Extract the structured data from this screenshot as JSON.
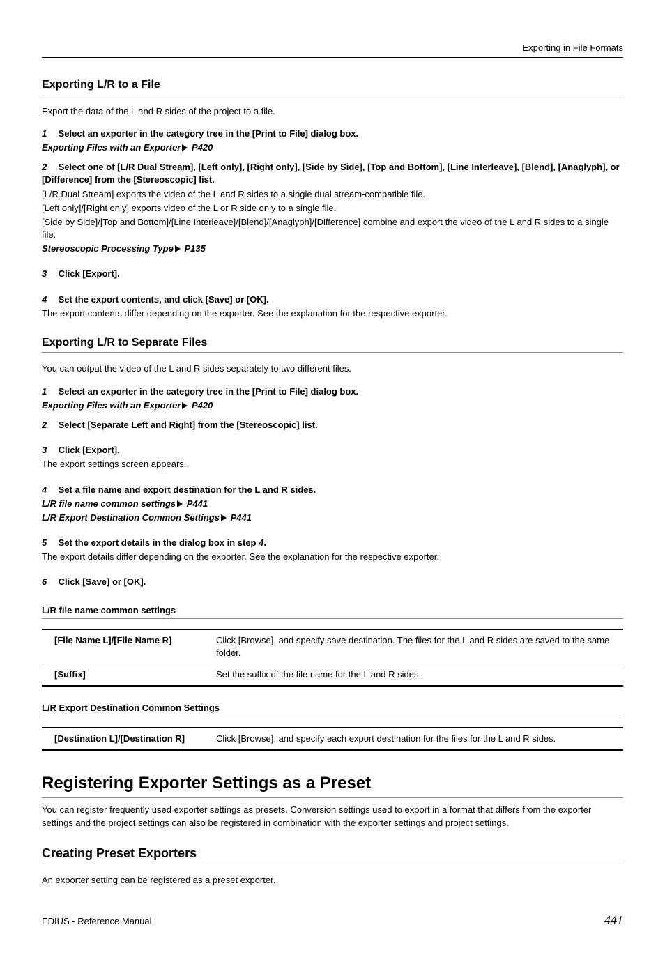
{
  "header": {
    "right": "Exporting in File Formats"
  },
  "sec1": {
    "title": "Exporting L/R to a File",
    "intro": "Export the data of the L and R sides of the project to a file.",
    "step1": {
      "num": "1",
      "text": "Select an exporter in the category tree in the [Print to File] dialog box."
    },
    "link1": {
      "label": "Exporting Files with an Exporter",
      "page": "P420"
    },
    "step2": {
      "num": "2",
      "text": "Select one of [L/R Dual Stream], [Left only], [Right only], [Side by Side], [Top and Bottom], [Line Interleave], [Blend], [Anaglyph], or [Difference] from the [Stereoscopic] list."
    },
    "body1": "[L/R Dual Stream] exports the video of the L and R sides to a single dual stream-compatible file.",
    "body2": "[Left only]/[Right only] exports video of the L or R side only to a single file.",
    "body3": "[Side by Side]/[Top and Bottom]/[Line Interleave]/[Blend]/[Anaglyph]/[Difference] combine and export the video of the L and R sides to a single file.",
    "link2": {
      "label": "Stereoscopic Processing Type",
      "page": "P135"
    },
    "step3": {
      "num": "3",
      "text": "Click [Export]."
    },
    "step4": {
      "num": "4",
      "text": "Set the export contents, and click [Save] or [OK]."
    },
    "body4": "The export contents differ depending on the exporter. See the explanation for the respective exporter."
  },
  "sec2": {
    "title": "Exporting L/R to Separate Files",
    "intro": "You can output the video of the L and R sides separately to two different files.",
    "step1": {
      "num": "1",
      "text": "Select an exporter in the category tree in the [Print to File] dialog box."
    },
    "link1": {
      "label": "Exporting Files with an Exporter",
      "page": "P420"
    },
    "step2": {
      "num": "2",
      "text": "Select [Separate Left and Right] from the [Stereoscopic] list."
    },
    "step3": {
      "num": "3",
      "text": "Click [Export]."
    },
    "body3": "The export settings screen appears.",
    "step4": {
      "num": "4",
      "text": "Set a file name and export destination for the L and R sides."
    },
    "link4a": {
      "label": "L/R file name common settings",
      "page": "P441"
    },
    "link4b": {
      "label": "L/R Export Destination Common Settings",
      "page": "P441"
    },
    "step5": {
      "num": "5",
      "text_a": "Set the export details in the dialog box in step ",
      "text_b": "4",
      "text_c": "."
    },
    "body5": "The export details differ depending on the exporter. See the explanation for the respective exporter.",
    "step6": {
      "num": "6",
      "text": "Click [Save] or [OK]."
    }
  },
  "table1": {
    "heading": "L/R file name common settings",
    "rows": [
      {
        "key": "[File Name L]/[File Name R]",
        "val": "Click [Browse], and specify save destination. The files for the L and R sides are saved to the same folder."
      },
      {
        "key": "[Suffix]",
        "val": "Set the suffix of the file name for the L and R sides."
      }
    ]
  },
  "table2": {
    "heading": "L/R Export Destination Common Settings",
    "rows": [
      {
        "key": "[Destination L]/[Destination R]",
        "val": "Click [Browse], and specify each export destination for the files for the L and R sides."
      }
    ]
  },
  "sec3": {
    "title": "Registering Exporter Settings as a Preset",
    "intro": "You can register frequently used exporter settings as presets. Conversion settings used to export in a format that differs from the exporter settings and the project settings can also be registered in combination with the exporter settings and project settings.",
    "sub_title": "Creating Preset Exporters",
    "sub_intro": "An exporter setting can be registered as a preset exporter."
  },
  "footer": {
    "left": "EDIUS - Reference Manual",
    "page": "441"
  }
}
